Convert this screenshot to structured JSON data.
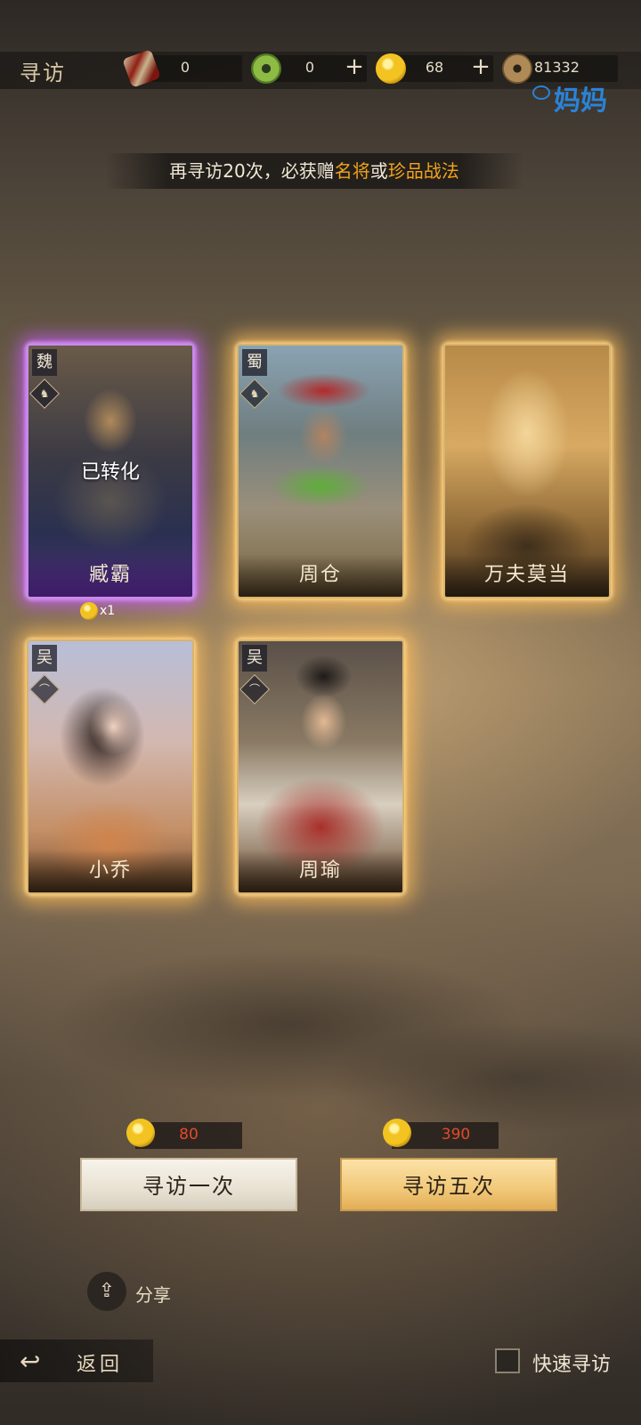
{
  "header": {
    "title": "寻访",
    "resources": [
      {
        "icon": "scroll-icon",
        "value": "0"
      },
      {
        "icon": "jade-icon",
        "value": "0"
      },
      {
        "icon": "gold-icon",
        "value": "68"
      },
      {
        "icon": "copper-coin-icon",
        "value": "81332"
      }
    ],
    "plus_label": "+"
  },
  "watermark": "妈妈",
  "banner": {
    "prefix": "再寻访20次，必获赠",
    "highlight1": "名将",
    "middle": "或",
    "highlight2": "珍品战法"
  },
  "cards": [
    {
      "name": "臧霸",
      "faction": "魏",
      "weapon": "horse",
      "frame": "purple",
      "status": "已转化",
      "reward": "x1"
    },
    {
      "name": "周仓",
      "faction": "蜀",
      "weapon": "horse",
      "frame": "gold"
    },
    {
      "name": "万夫莫当",
      "frame": "gold"
    },
    {
      "name": "小乔",
      "faction": "吴",
      "weapon": "bow",
      "frame": "gold"
    },
    {
      "name": "周瑜",
      "faction": "吴",
      "weapon": "bow",
      "frame": "gold"
    }
  ],
  "actions": {
    "once": {
      "cost": "80",
      "label": "寻访一次"
    },
    "five": {
      "cost": "390",
      "label": "寻访五次"
    }
  },
  "share_label": "分享",
  "back_label": "返回",
  "quick_label": "快速寻访",
  "colors": {
    "highlight": "#f2a41c",
    "cost": "#e44a2a",
    "gold_glow": "#ffbe5a",
    "purple_glow": "#c85aff"
  }
}
